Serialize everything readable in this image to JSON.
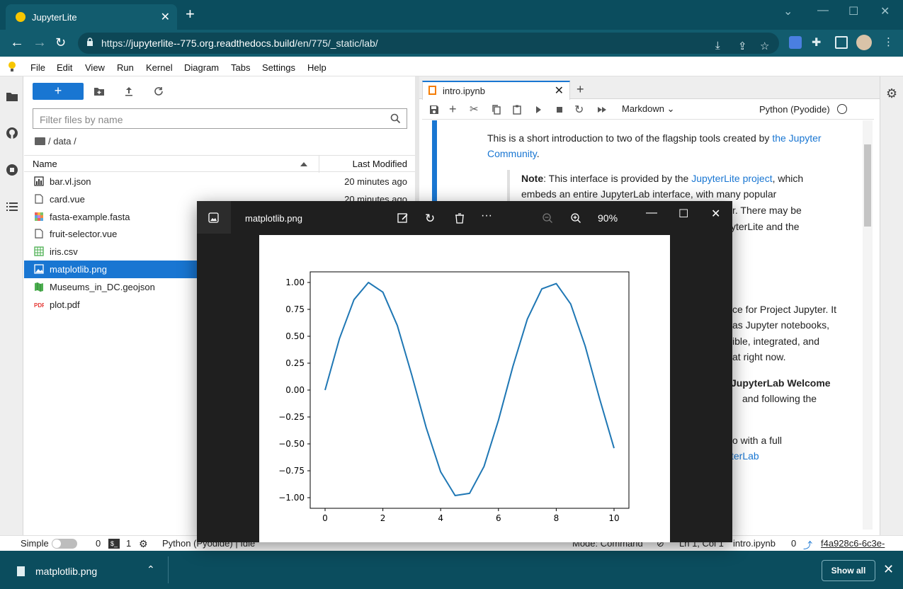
{
  "browser": {
    "tab_title": "JupyterLite",
    "url_prefix": "https://",
    "url_host": "jupyterlite--775.org.readthedocs.build",
    "url_path": "/en/775/_static/lab/"
  },
  "menu": [
    "File",
    "Edit",
    "View",
    "Run",
    "Kernel",
    "Diagram",
    "Tabs",
    "Settings",
    "Help"
  ],
  "filebrowser": {
    "new_label": "+",
    "filter_placeholder": "Filter files by name",
    "breadcrumb": "/ data /",
    "col_name": "Name",
    "col_modified": "Last Modified",
    "files": [
      {
        "name": "bar.vl.json",
        "modified": "20 minutes ago",
        "icon": "vega-chart-icon"
      },
      {
        "name": "card.vue",
        "modified": "20 minutes ago",
        "icon": "file-icon"
      },
      {
        "name": "fasta-example.fasta",
        "modified": "",
        "icon": "fasta-icon"
      },
      {
        "name": "fruit-selector.vue",
        "modified": "",
        "icon": "file-icon"
      },
      {
        "name": "iris.csv",
        "modified": "",
        "icon": "spreadsheet-icon"
      },
      {
        "name": "matplotlib.png",
        "modified": "",
        "icon": "image-icon"
      },
      {
        "name": "Museums_in_DC.geojson",
        "modified": "",
        "icon": "map-icon"
      },
      {
        "name": "plot.pdf",
        "modified": "",
        "icon": "pdf-icon"
      }
    ]
  },
  "notebook": {
    "tab_name": "intro.ipynb",
    "cell_type": "Markdown",
    "kernel": "Python (Pyodide)",
    "p1_text": "This is a short introduction to two of the flagship tools created by ",
    "p1_link": "the Jupyter",
    "p1_link2": "Community",
    "p1_end": ".",
    "note_label": "Note",
    "note_text": ": This interface is provided by the ",
    "note_link": "JupyterLite project",
    "note_tail": ", which",
    "note_line2": "embeds an entire JupyterLab interface, with many popular",
    "note_line3": "r. There may be",
    "note_line4": "yterLite and the",
    "p2_line1": "ce for Project Jupyter. It",
    "p2_line2": "as Jupyter notebooks,",
    "p2_line3": "ible, integrated, and",
    "p2_line4": "at right now.",
    "p3_line1": "JupyterLab Welcome",
    "p3_line2": "and following the",
    "p4_line1": "o with a full",
    "p4_link": "terLab"
  },
  "statusbar": {
    "mode_label": "Simple",
    "terminals": "0",
    "kernels": "1",
    "kernel_status": "Python (Pyodide) | Idle",
    "mode": "Mode: Command",
    "position": "Ln 1, Col 1",
    "file": "intro.ipynb",
    "count": "0",
    "hash": "f4a928c6-6c3e-"
  },
  "downloads": {
    "file": "matplotlib.png",
    "show_all": "Show all"
  },
  "viewer": {
    "title": "matplotlib.png",
    "zoom": "90%"
  },
  "chart_data": {
    "type": "line",
    "title": "",
    "xlabel": "",
    "ylabel": "",
    "xlim": [
      0,
      10
    ],
    "ylim": [
      -1.0,
      1.0
    ],
    "x_ticks": [
      "0",
      "2",
      "4",
      "6",
      "8",
      "10"
    ],
    "y_ticks": [
      "1.00",
      "0.75",
      "0.50",
      "0.25",
      "0.00",
      "−0.25",
      "−0.50",
      "−0.75",
      "−1.00"
    ],
    "grid": false,
    "series": [
      {
        "color": "#1f77b4",
        "x": [
          0,
          0.5,
          1.0,
          1.5,
          2.0,
          2.5,
          3.0,
          3.5,
          4.0,
          4.5,
          5.0,
          5.5,
          6.0,
          6.5,
          7.0,
          7.5,
          8.0,
          8.5,
          9.0,
          9.5,
          10.0
        ],
        "y": [
          0.0,
          0.48,
          0.84,
          1.0,
          0.91,
          0.6,
          0.14,
          -0.35,
          -0.76,
          -0.98,
          -0.96,
          -0.71,
          -0.28,
          0.22,
          0.66,
          0.94,
          0.99,
          0.8,
          0.41,
          -0.08,
          -0.54
        ]
      }
    ]
  }
}
